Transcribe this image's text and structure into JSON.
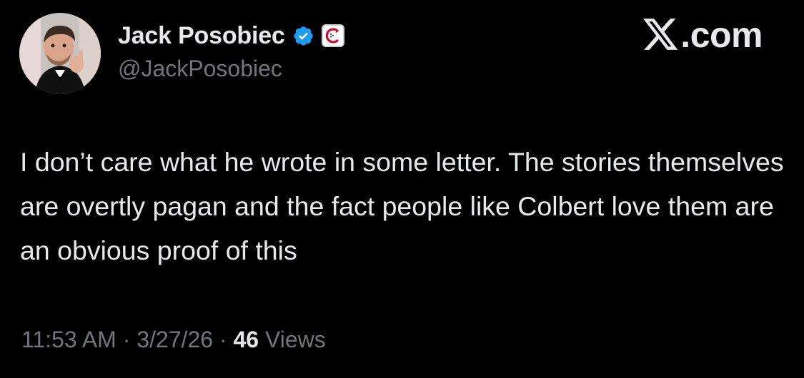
{
  "author": {
    "display_name": "Jack Posobiec",
    "handle": "@JackPosobiec",
    "verified_icon": "verified-checkmark-icon",
    "verified_color": "#1d9bf0",
    "affiliate_badge_icon": "affiliate-badge-icon"
  },
  "watermark": {
    "logo_icon": "x-logo-icon",
    "suffix": ".com"
  },
  "tweet": {
    "text": "I don’t care what he wrote in some letter. The stories themselves are overtly pagan and the fact people like Colbert love them are an obvious proof of this",
    "time": "11:53 AM",
    "separator": " · ",
    "date": "3/27/26",
    "views_count": "46",
    "views_label": " Views"
  },
  "colors": {
    "background": "#000000",
    "primary_text": "#e7e9ea",
    "secondary_text": "#71767b"
  }
}
